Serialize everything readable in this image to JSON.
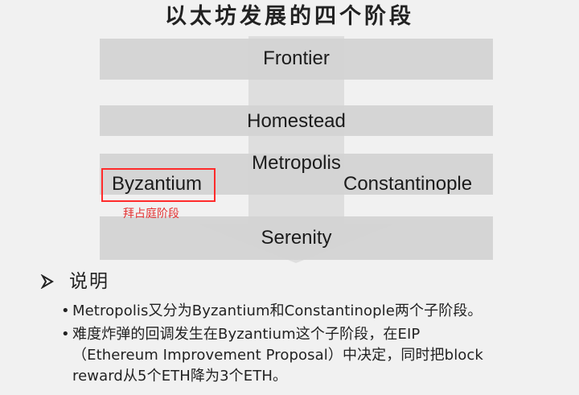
{
  "slide": {
    "title": "以太坊发展的四个阶段",
    "annotation": "拜占庭阶段",
    "heading": "说明"
  },
  "stages": [
    {
      "name": "Frontier"
    },
    {
      "name": "Homestead"
    },
    {
      "name": "Metropolis"
    },
    {
      "name": "Serenity"
    }
  ],
  "substages": [
    {
      "name": "Byzantium"
    },
    {
      "name": "Constantinople"
    }
  ],
  "bullets": [
    {
      "lines": [
        "Metropolis又分为Byzantium和Constantinople两个子阶段。"
      ]
    },
    {
      "lines": [
        "难度炸弹的回调发生在Byzantium这个子阶段，在EIP",
        "（Ethereum Improvement Proposal）中决定，同时把block",
        "reward从5个ETH降为3个ETH。"
      ]
    }
  ],
  "colors": {
    "background": "#f1f1f1",
    "stage_fill": "#d2d2d2",
    "arrow_fill": "#dedede",
    "highlight_red": "#ff2b2b",
    "text": "#222222"
  },
  "icons": {
    "heading_bullet": "arrow-bullet-icon"
  }
}
